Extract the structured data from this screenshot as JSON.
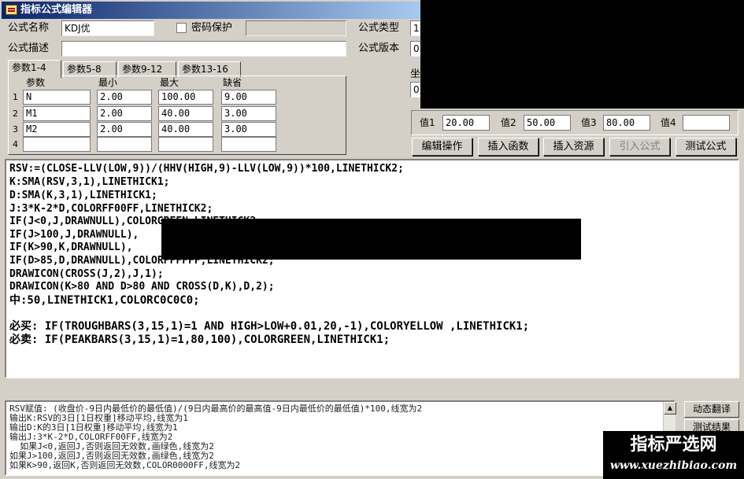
{
  "window": {
    "title": "指标公式编辑器"
  },
  "form": {
    "name_label": "公式名称",
    "name_value": "KDJ优",
    "password_label": "密码保护",
    "desc_label": "公式描述",
    "desc_value": "",
    "type_label": "公式类型",
    "type_value": "1",
    "version_label": "公式版本",
    "version_value": "0",
    "coord_label": "坐",
    "coord_value": "0"
  },
  "tabs": [
    {
      "label": "参数1-4"
    },
    {
      "label": "参数5-8"
    },
    {
      "label": "参数9-12"
    },
    {
      "label": "参数13-16"
    }
  ],
  "params": {
    "headers": {
      "name": "参数",
      "min": "最小",
      "max": "最大",
      "default": "缺省"
    },
    "rows": [
      {
        "num": "1",
        "name": "N",
        "min": "2.00",
        "max": "100.00",
        "default": "9.00"
      },
      {
        "num": "2",
        "name": "M1",
        "min": "2.00",
        "max": "40.00",
        "default": "3.00"
      },
      {
        "num": "3",
        "name": "M2",
        "min": "2.00",
        "max": "40.00",
        "default": "3.00"
      },
      {
        "num": "4",
        "name": "",
        "min": "",
        "max": "",
        "default": ""
      }
    ]
  },
  "values": [
    {
      "label": "值1",
      "value": "20.00"
    },
    {
      "label": "值2",
      "value": "50.00"
    },
    {
      "label": "值3",
      "value": "80.00"
    },
    {
      "label": "值4",
      "value": ""
    }
  ],
  "buttons": {
    "edit_ops": "编辑操作",
    "insert_func": "插入函数",
    "insert_res": "插入资源",
    "import_formula": "引入公式",
    "test_formula": "测试公式",
    "translate": "动态翻译",
    "test_result": "测试结果"
  },
  "code": {
    "l1": "RSV:=(CLOSE-LLV(LOW,9))/(HHV(HIGH,9)-LLV(LOW,9))*100,LINETHICK2;",
    "l2": "K:SMA(RSV,3,1),LINETHICK1;",
    "l3": "D:SMA(K,3,1),LINETHICK1;",
    "l4": "J:3*K-2*D,COLORFF00FF,LINETHICK2;",
    "l5": "IF(J<0,J,DRAWNULL),COLORGREEN,LINETHICK2;",
    "l6": "IF(J>100,J,DRAWNULL),",
    "l7": "IF(K>90,K,DRAWNULL),",
    "l8": "IF(D>85,D,DRAWNULL),COLORFFFFFF,LINETHICK2;",
    "l9": "DRAWICON(CROSS(J,2),J,1);",
    "l10": "DRAWICON(K>80 AND D>80 AND CROSS(D,K),D,2);",
    "l11": "中:50,LINETHICK1,COLORC0C0C0;",
    "l12": "必买: IF(TROUGHBARS(3,15,1)=1 AND HIGH>LOW+0.01,20,-1),COLORYELLOW ,LINETHICK1;",
    "l13": "必卖: IF(PEAKBARS(3,15,1)=1,80,100),COLORGREEN,LINETHICK1;"
  },
  "translation": {
    "t1": "RSV赋值: (收盘价-9日内最低价的最低值)/(9日内最高价的最高值-9日内最低价的最低值)*100,线宽为2",
    "t2": "输出K:RSV的3日[1日权重]移动平均,线宽为1",
    "t3": "输出D:K的3日[1日权重]移动平均,线宽为1",
    "t4": "输出J:3*K-2*D,COLORFF00FF,线宽为2",
    "t5": "  如果J<0,返回J,否则返回无效数,画绿色,线宽为2",
    "t6": "如果J>100,返回J,否则返回无效数,画绿色,线宽为2",
    "t7": "如果K>90,返回K,否则返回无效数,COLOR0000FF,线宽为2"
  },
  "watermark": {
    "name": "指标严选网",
    "url": "www.xuezhibiao.com"
  }
}
